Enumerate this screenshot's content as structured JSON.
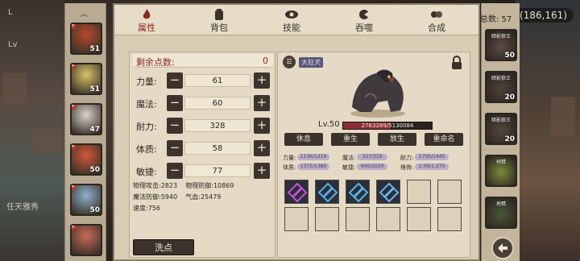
{
  "coords": "(186,161)",
  "left_labels": [
    "L",
    "Lv",
    "任天雅秀"
  ],
  "tabs": [
    {
      "label": "属性",
      "icon": "flame-icon",
      "active": true
    },
    {
      "label": "背包",
      "icon": "backpack-icon",
      "active": false
    },
    {
      "label": "技能",
      "icon": "eye-icon",
      "active": false
    },
    {
      "label": "吞噬",
      "icon": "devour-icon",
      "active": false
    },
    {
      "label": "合成",
      "icon": "merge-icon",
      "active": false
    }
  ],
  "heroes": [
    {
      "level": "51",
      "color": "#b84a2e"
    },
    {
      "level": "51",
      "color": "#d9c26a"
    },
    {
      "level": "47",
      "color": "#d8d4cc"
    },
    {
      "level": "50",
      "color": "#d2583a"
    },
    {
      "level": "50",
      "color": "#8fb0cf"
    },
    {
      "level": "",
      "color": "#c86a5a"
    }
  ],
  "points": {
    "label": "剩余点数:",
    "value": "0"
  },
  "stats": [
    {
      "name": "力量:",
      "value": "61"
    },
    {
      "name": "魔法:",
      "value": "60"
    },
    {
      "name": "耐力:",
      "value": "328"
    },
    {
      "name": "体质:",
      "value": "58"
    },
    {
      "name": "敏捷:",
      "value": "77"
    }
  ],
  "derived": [
    {
      "label": "物理攻击:",
      "value": "2823"
    },
    {
      "label": "物理防御:",
      "value": "10869"
    },
    {
      "label": "魔法防御:",
      "value": "5940"
    },
    {
      "label": "气血:",
      "value": "25479"
    },
    {
      "label": "速度:",
      "value": "756"
    }
  ],
  "wash_button": "洗点",
  "pet": {
    "tag": "大狂犬",
    "info_icon": "list-icon",
    "level": "Lv.50",
    "exp": "2763289/5130084",
    "exp_fraction": 0.539,
    "actions": [
      "休息",
      "重生",
      "放生",
      "重命名"
    ],
    "attributes": [
      {
        "label": "力量:",
        "value": "1136/1210"
      },
      {
        "label": "魔法:",
        "value": "327/329"
      },
      {
        "label": "耐力:",
        "value": "1705/1440"
      },
      {
        "label": "体质:",
        "value": "1375/1380"
      },
      {
        "label": "敏捷:",
        "value": "940/1020"
      },
      {
        "label": "根骨:",
        "value": "1.09/1.270"
      }
    ]
  },
  "skills": [
    {
      "icon": "pink-crystal-icon",
      "color": "#c94fd6"
    },
    {
      "icon": "blue-slash-icon",
      "color": "#5aaee8"
    },
    {
      "icon": "water-swirl-icon",
      "color": "#57b7e8"
    },
    {
      "icon": "shield-slash-icon",
      "color": "#6bb2f0"
    }
  ],
  "total": "总数: 57",
  "pets": [
    {
      "name": "暗影狼王",
      "level": "50",
      "color": "#5a4a44"
    },
    {
      "name": "暗影狼王",
      "level": "20",
      "color": "#4e413c"
    },
    {
      "name": "暗影狼王",
      "level": "20",
      "color": "#54463f"
    },
    {
      "name": "树精",
      "level": "",
      "color": "#7a8a3a"
    },
    {
      "name": "地精",
      "level": "",
      "color": "#4a5638"
    }
  ]
}
